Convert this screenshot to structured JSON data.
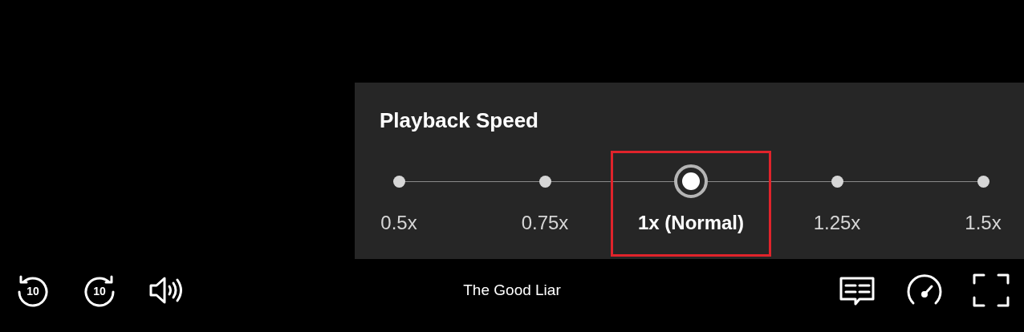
{
  "speed_panel": {
    "title": "Playback Speed",
    "options": [
      {
        "label": "0.5x",
        "selected": false,
        "highlighted": false
      },
      {
        "label": "0.75x",
        "selected": false,
        "highlighted": false
      },
      {
        "label": "1x (Normal)",
        "selected": true,
        "highlighted": true
      },
      {
        "label": "1.25x",
        "selected": false,
        "highlighted": false
      },
      {
        "label": "1.5x",
        "selected": false,
        "highlighted": false
      }
    ]
  },
  "controls": {
    "left": [
      {
        "kind": "rewind",
        "label": "10"
      },
      {
        "kind": "forward",
        "label": "10"
      },
      {
        "kind": "volume"
      }
    ],
    "title": "The Good Liar",
    "right": [
      {
        "kind": "subtitles"
      },
      {
        "kind": "speed"
      },
      {
        "kind": "fullscreen"
      }
    ]
  }
}
